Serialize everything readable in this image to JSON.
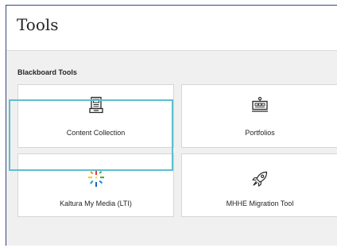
{
  "header": {
    "title": "Tools"
  },
  "section": {
    "label": "Blackboard Tools"
  },
  "tiles": [
    {
      "label": "Content Collection",
      "icon": "archive-drawer-icon"
    },
    {
      "label": "Portfolios",
      "icon": "portfolio-presentation-icon"
    },
    {
      "label": "Kaltura My Media (LTI)",
      "icon": "kaltura-burst-icon"
    },
    {
      "label": "MHHE Migration Tool",
      "icon": "rocket-icon"
    }
  ],
  "colors": {
    "panel_border": "#2f4a7a",
    "focus_ring": "#5cbfd0",
    "content_bg": "#f0f0f0"
  }
}
